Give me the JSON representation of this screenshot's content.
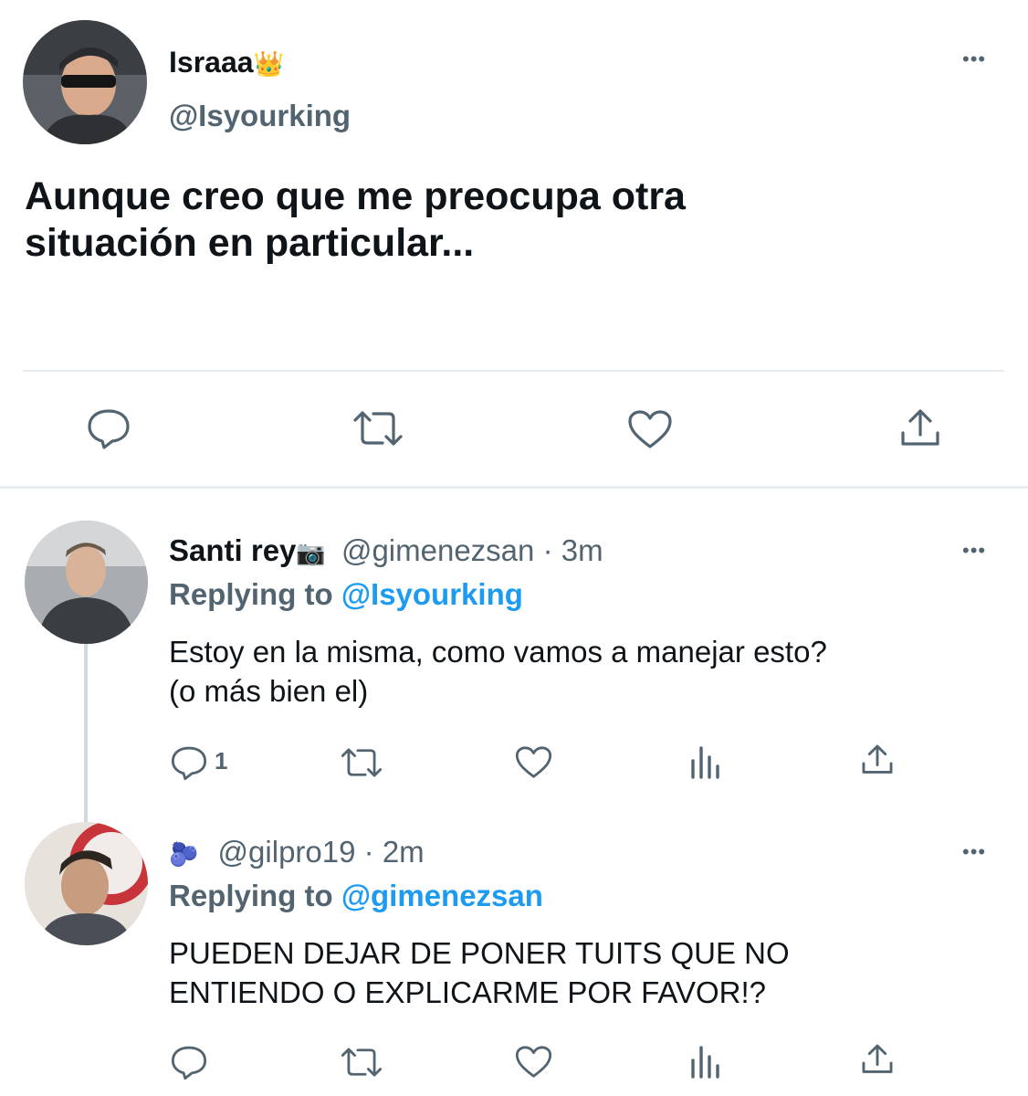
{
  "main_tweet": {
    "display_name": "Israaa",
    "name_emoji": "👑",
    "handle": "@Isyourking",
    "text_line1": "Aunque creo que me preocupa otra",
    "text_line2": "situación en particular..."
  },
  "reply1": {
    "display_name": "Santi rey",
    "name_emoji": "📷",
    "handle": "@gimenezsan",
    "sep": "·",
    "time": "3m",
    "replying_prefix": "Replying to",
    "replying_to": "@Isyourking",
    "text_line1": "Estoy en la misma, como vamos a manejar esto?",
    "text_line2": "(o más bien el)",
    "reply_count": "1"
  },
  "reply2": {
    "name_emoji": "🫐",
    "handle": "@gilpro19",
    "sep": "·",
    "time": "2m",
    "replying_prefix": "Replying to",
    "replying_to": "@gimenezsan",
    "text_line1": "PUEDEN DEJAR DE PONER TUITS QUE NO",
    "text_line2": "ENTIENDO O EXPLICARME POR FAVOR!?"
  },
  "more_glyph": "•••",
  "colors": {
    "accent": "#1d9bf0",
    "muted": "#536471",
    "text": "#0f1419",
    "divider": "#e6ecf0"
  }
}
